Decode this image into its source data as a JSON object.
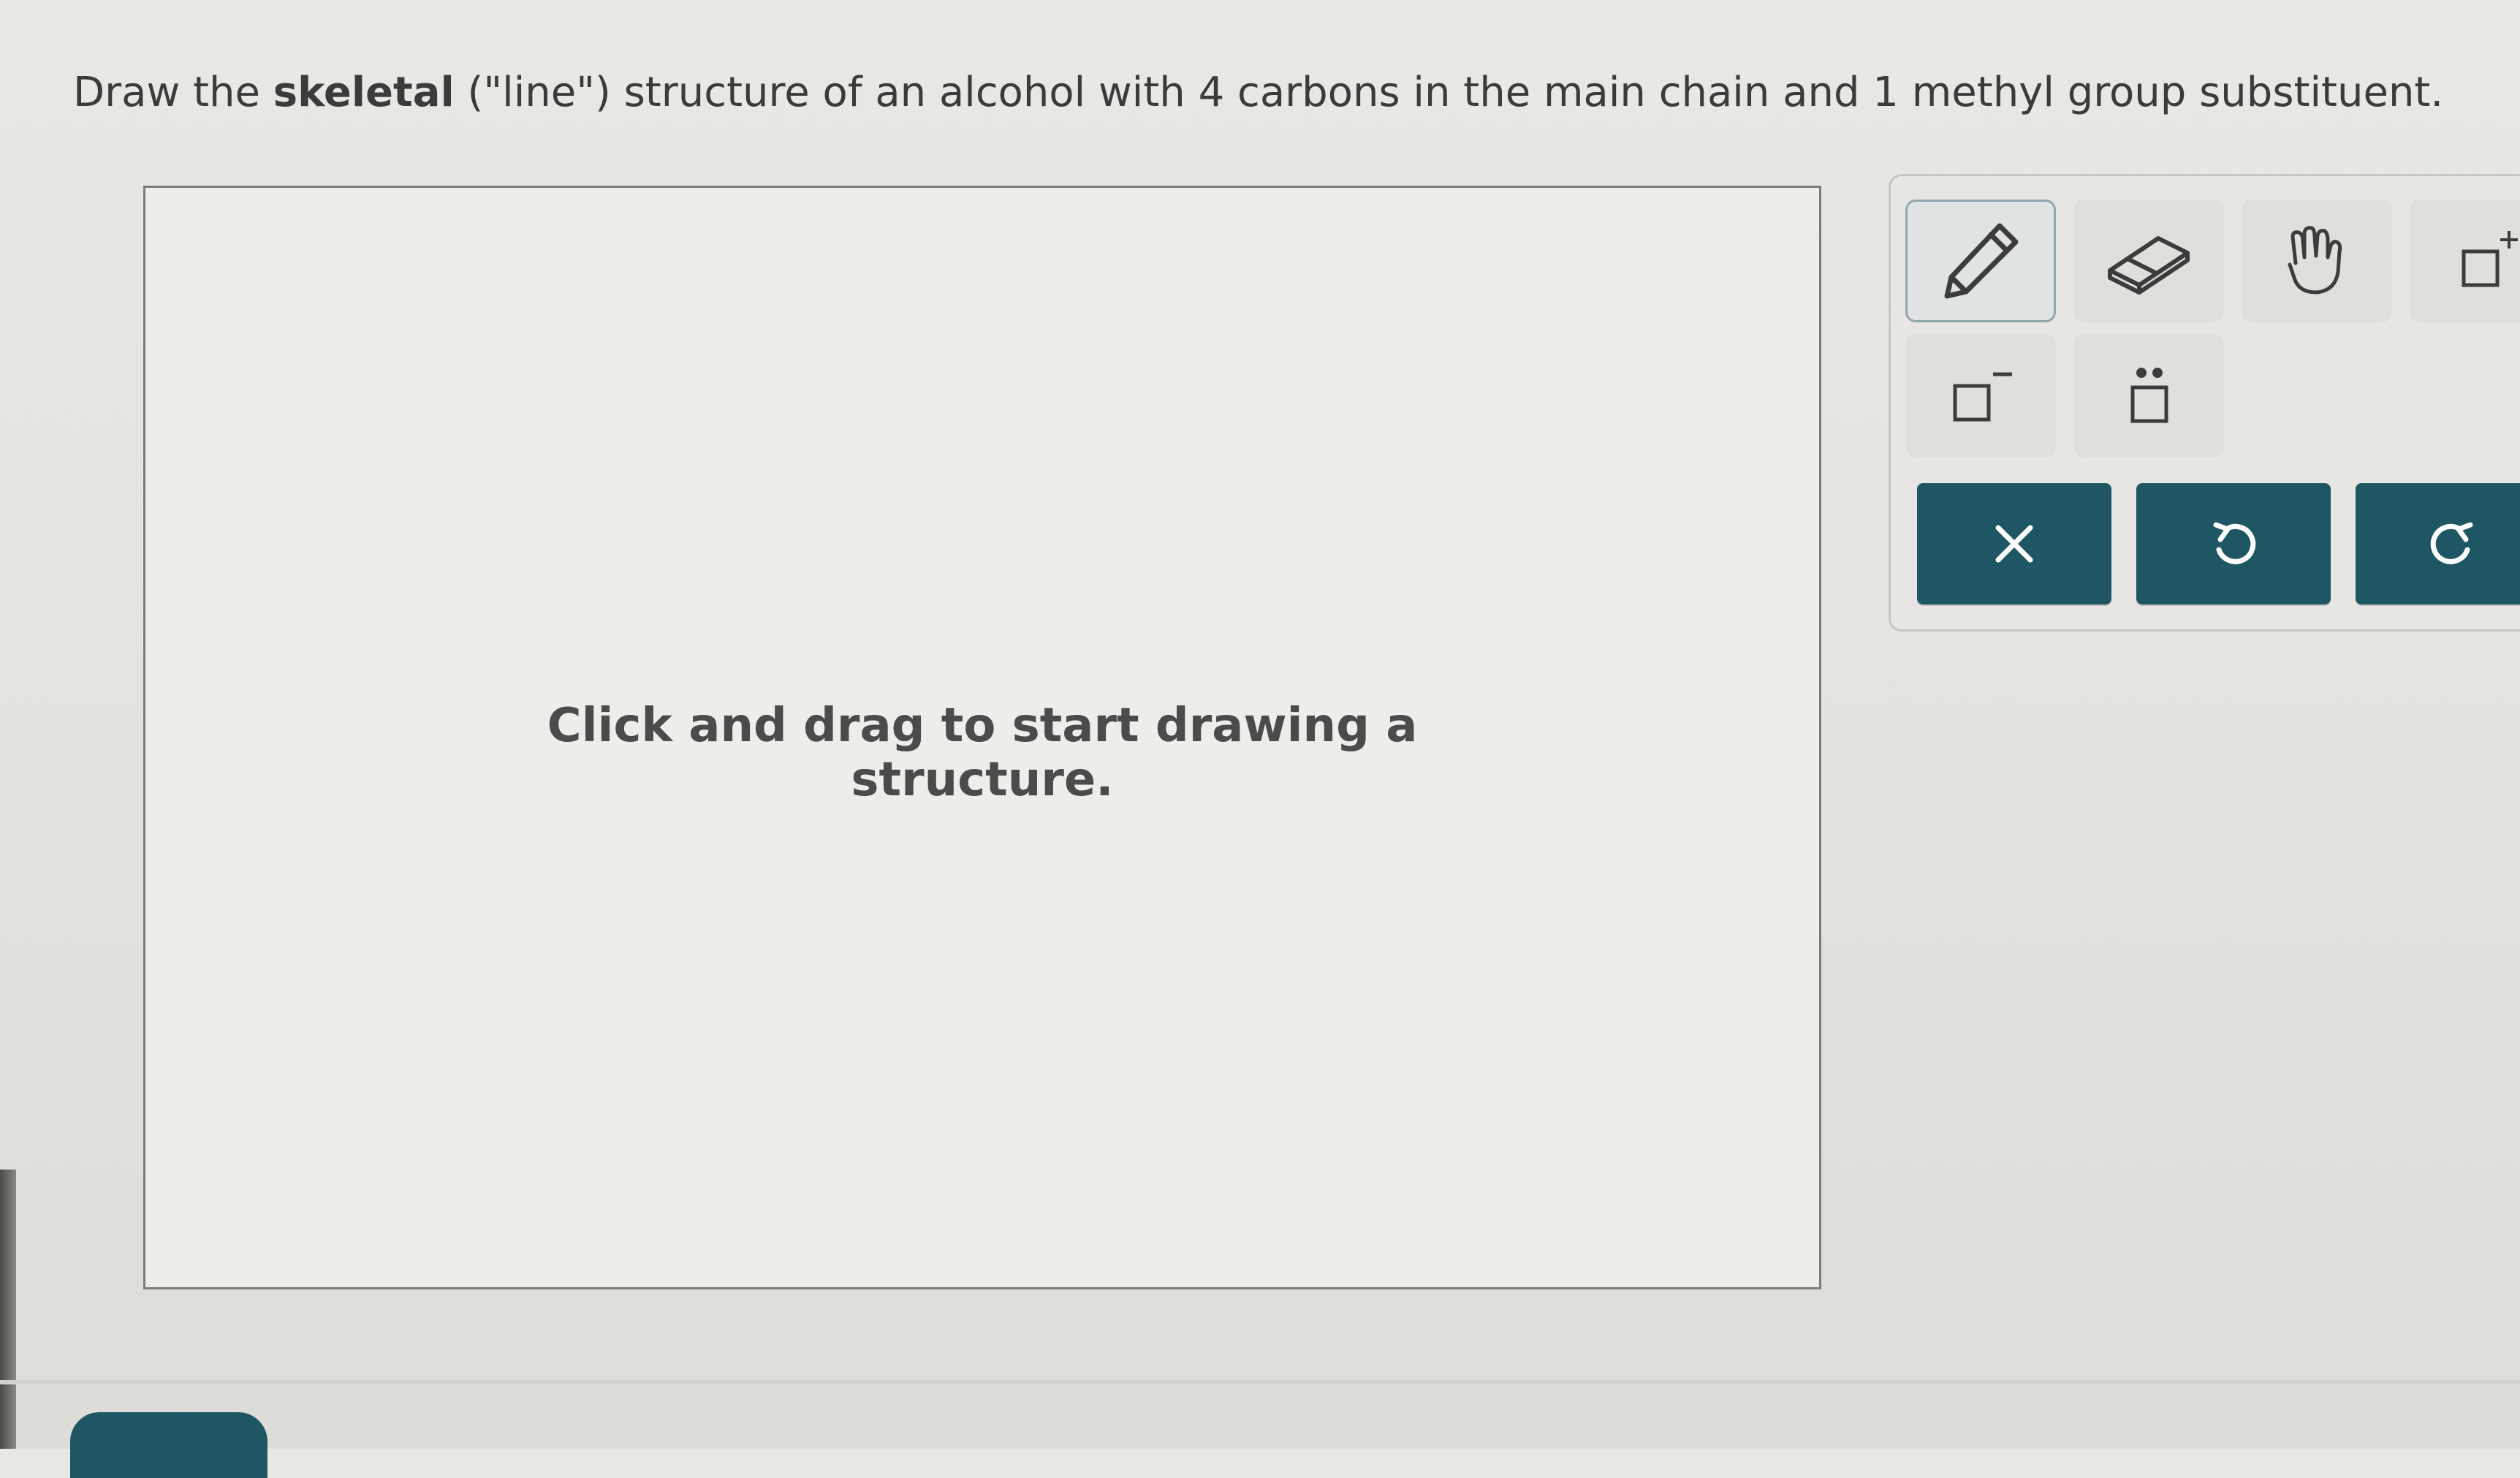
{
  "question": {
    "prefix": "Draw the ",
    "bold": "skeletal",
    "suffix": " (\"line\") structure of an alcohol with 4 carbons in the main chain and 1 methyl group substituent."
  },
  "canvas": {
    "hint": "Click and drag to start drawing a structure."
  },
  "toolbar": {
    "tools": [
      {
        "name": "pencil-tool",
        "icon": "pencil-icon",
        "selected": true
      },
      {
        "name": "eraser-tool",
        "icon": "eraser-icon",
        "selected": false
      },
      {
        "name": "hand-tool",
        "icon": "hand-icon",
        "selected": false
      },
      {
        "name": "positive-charge-tool",
        "icon": "square-plus-icon",
        "selected": false
      },
      {
        "name": "negative-charge-tool",
        "icon": "square-minus-icon",
        "selected": false
      },
      {
        "name": "lone-pair-tool",
        "icon": "lone-pair-icon",
        "selected": false
      }
    ],
    "actions": [
      {
        "name": "clear-button",
        "icon": "close-icon"
      },
      {
        "name": "undo-button",
        "icon": "undo-icon"
      },
      {
        "name": "redo-button",
        "icon": "redo-icon"
      }
    ]
  },
  "colors": {
    "accent": "#1f5663",
    "selected_border": "#8fa7ab",
    "canvas_bg": "#eeede9",
    "page_bg": "#e6e5e1"
  }
}
